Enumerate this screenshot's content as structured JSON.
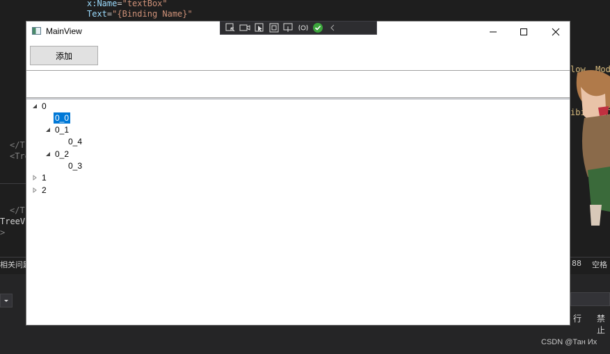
{
  "window": {
    "title": "MainView",
    "add_button_label": "添加",
    "textbox_value": ""
  },
  "tree": {
    "nodes": [
      {
        "label": "0",
        "level": 0,
        "expanded": true
      },
      {
        "label": "0_0",
        "level": 1,
        "leaf": true,
        "selected": true
      },
      {
        "label": "0_1",
        "level": 1,
        "expanded": true
      },
      {
        "label": "0_4",
        "level": 2,
        "leaf": true
      },
      {
        "label": "0_2",
        "level": 1,
        "expanded": true
      },
      {
        "label": "0_3",
        "level": 2,
        "leaf": true
      },
      {
        "label": "1",
        "level": 0,
        "expanded": false
      },
      {
        "label": "2",
        "level": 0,
        "expanded": false
      }
    ]
  },
  "ide": {
    "line1_attr": "x:Name",
    "line1_eq": "=",
    "line1_val": "\"textBox\"",
    "line2_attr": "Text",
    "line2_eq": "=",
    "line2_val": "\"{Binding Name}\"",
    "right_frag1": "low, Mode",
    "right_frag2": "ibilityCo",
    "left_frag1": "</T",
    "left_frag2": "<Tre",
    "left_frag3": "</T",
    "left_frag4": "TreeVi",
    "left_frag5": ">",
    "status_left": "相关问题",
    "status_num": "88",
    "status_space": "空格",
    "panel_r1": "行",
    "panel_r2": "禁止"
  },
  "watermark": "CSDN @Тан Их",
  "colors": {
    "selection": "#0078d7",
    "button_bg": "#e1e1e1"
  }
}
